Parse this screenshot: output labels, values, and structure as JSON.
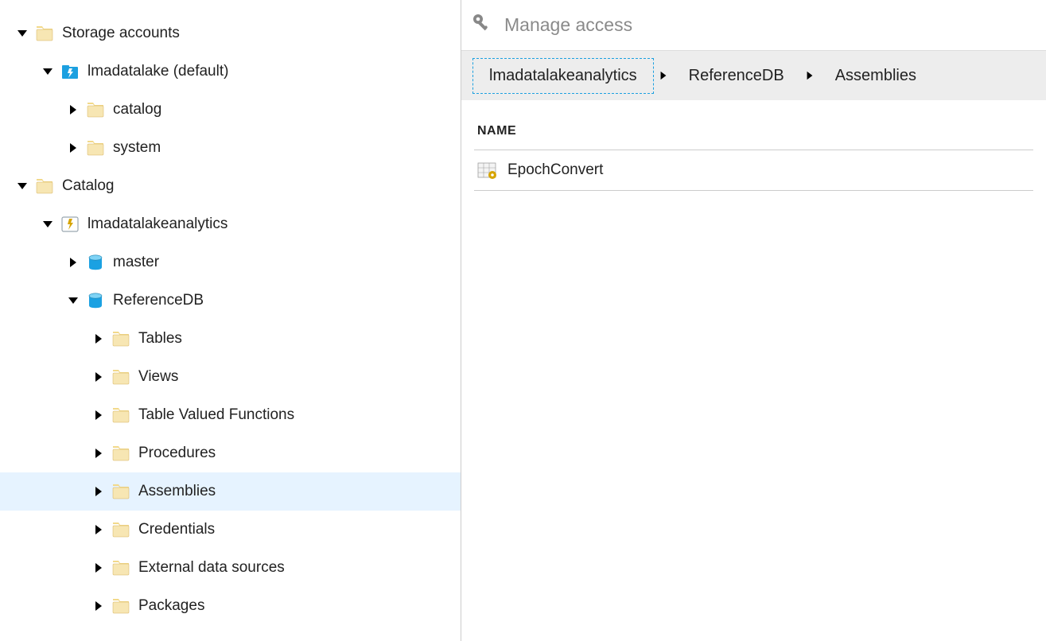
{
  "tree": {
    "storage_accounts": {
      "label": "Storage accounts",
      "expanded": true,
      "icon": "folder-icon"
    },
    "lmadatalake": {
      "label": "lmadatalake (default)",
      "expanded": true,
      "icon": "storage-bolt-icon"
    },
    "storage_catalog": {
      "label": "catalog",
      "expanded": false,
      "icon": "folder-icon"
    },
    "storage_system": {
      "label": "system",
      "expanded": false,
      "icon": "folder-icon"
    },
    "catalog_root": {
      "label": "Catalog",
      "expanded": true,
      "icon": "folder-icon"
    },
    "analytics_acct": {
      "label": "lmadatalakeanalytics",
      "expanded": true,
      "icon": "analytics-bolt-icon"
    },
    "db_master": {
      "label": "master",
      "expanded": false,
      "icon": "database-icon"
    },
    "db_reference": {
      "label": "ReferenceDB",
      "expanded": true,
      "icon": "database-icon"
    },
    "tables": {
      "label": "Tables",
      "expanded": false,
      "icon": "folder-icon"
    },
    "views": {
      "label": "Views",
      "expanded": false,
      "icon": "folder-icon"
    },
    "tvf": {
      "label": "Table Valued Functions",
      "expanded": false,
      "icon": "folder-icon"
    },
    "procedures": {
      "label": "Procedures",
      "expanded": false,
      "icon": "folder-icon"
    },
    "assemblies": {
      "label": "Assemblies",
      "expanded": false,
      "icon": "folder-icon",
      "selected": true
    },
    "credentials": {
      "label": "Credentials",
      "expanded": false,
      "icon": "folder-icon"
    },
    "ext_data_sources": {
      "label": "External data sources",
      "expanded": false,
      "icon": "folder-icon"
    },
    "packages": {
      "label": "Packages",
      "expanded": false,
      "icon": "folder-icon"
    }
  },
  "header": {
    "manage_label": "Manage access"
  },
  "breadcrumb": {
    "items": [
      {
        "label": "lmadatalakeanalytics",
        "current": true
      },
      {
        "label": "ReferenceDB",
        "current": false
      },
      {
        "label": "Assemblies",
        "current": false
      }
    ]
  },
  "table": {
    "name_header": "NAME",
    "rows": [
      {
        "name": "EpochConvert"
      }
    ]
  }
}
